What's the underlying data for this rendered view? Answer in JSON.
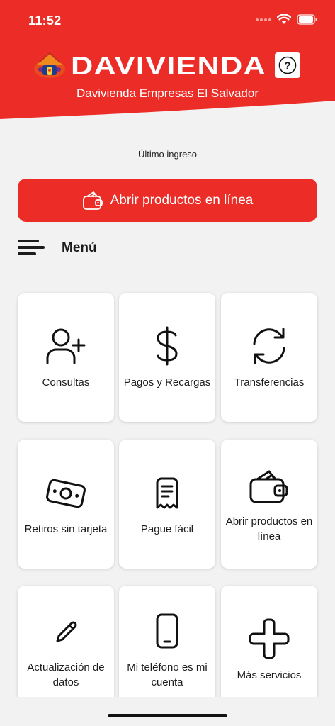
{
  "status_bar": {
    "time": "11:52"
  },
  "header": {
    "brand_name": "DAVIVIENDA",
    "subtitle": "Davivienda Empresas El Salvador",
    "help_label": "?",
    "accent_color": "#ec2d27"
  },
  "last_login": "Último ingreso",
  "open_products_button": {
    "label": "Abrir productos en línea",
    "icon": "wallet-icon"
  },
  "menu": {
    "title": "Menú",
    "icon": "hamburger-icon"
  },
  "tiles": [
    {
      "label": "Consultas",
      "icon": "user-plus-icon"
    },
    {
      "label": "Pagos y Recargas",
      "icon": "dollar-icon"
    },
    {
      "label": "Transferencias",
      "icon": "refresh-icon"
    },
    {
      "label": "Retiros sin tarjeta",
      "icon": "cash-icon"
    },
    {
      "label": "Pague fácil",
      "icon": "receipt-icon"
    },
    {
      "label": "Abrir productos en línea",
      "icon": "wallet-icon"
    },
    {
      "label": "Actualización de datos",
      "icon": "pencil-icon"
    },
    {
      "label": "Mi teléfono es mi cuenta",
      "icon": "phone-icon"
    },
    {
      "label": "Más servicios",
      "icon": "plus-icon"
    }
  ]
}
